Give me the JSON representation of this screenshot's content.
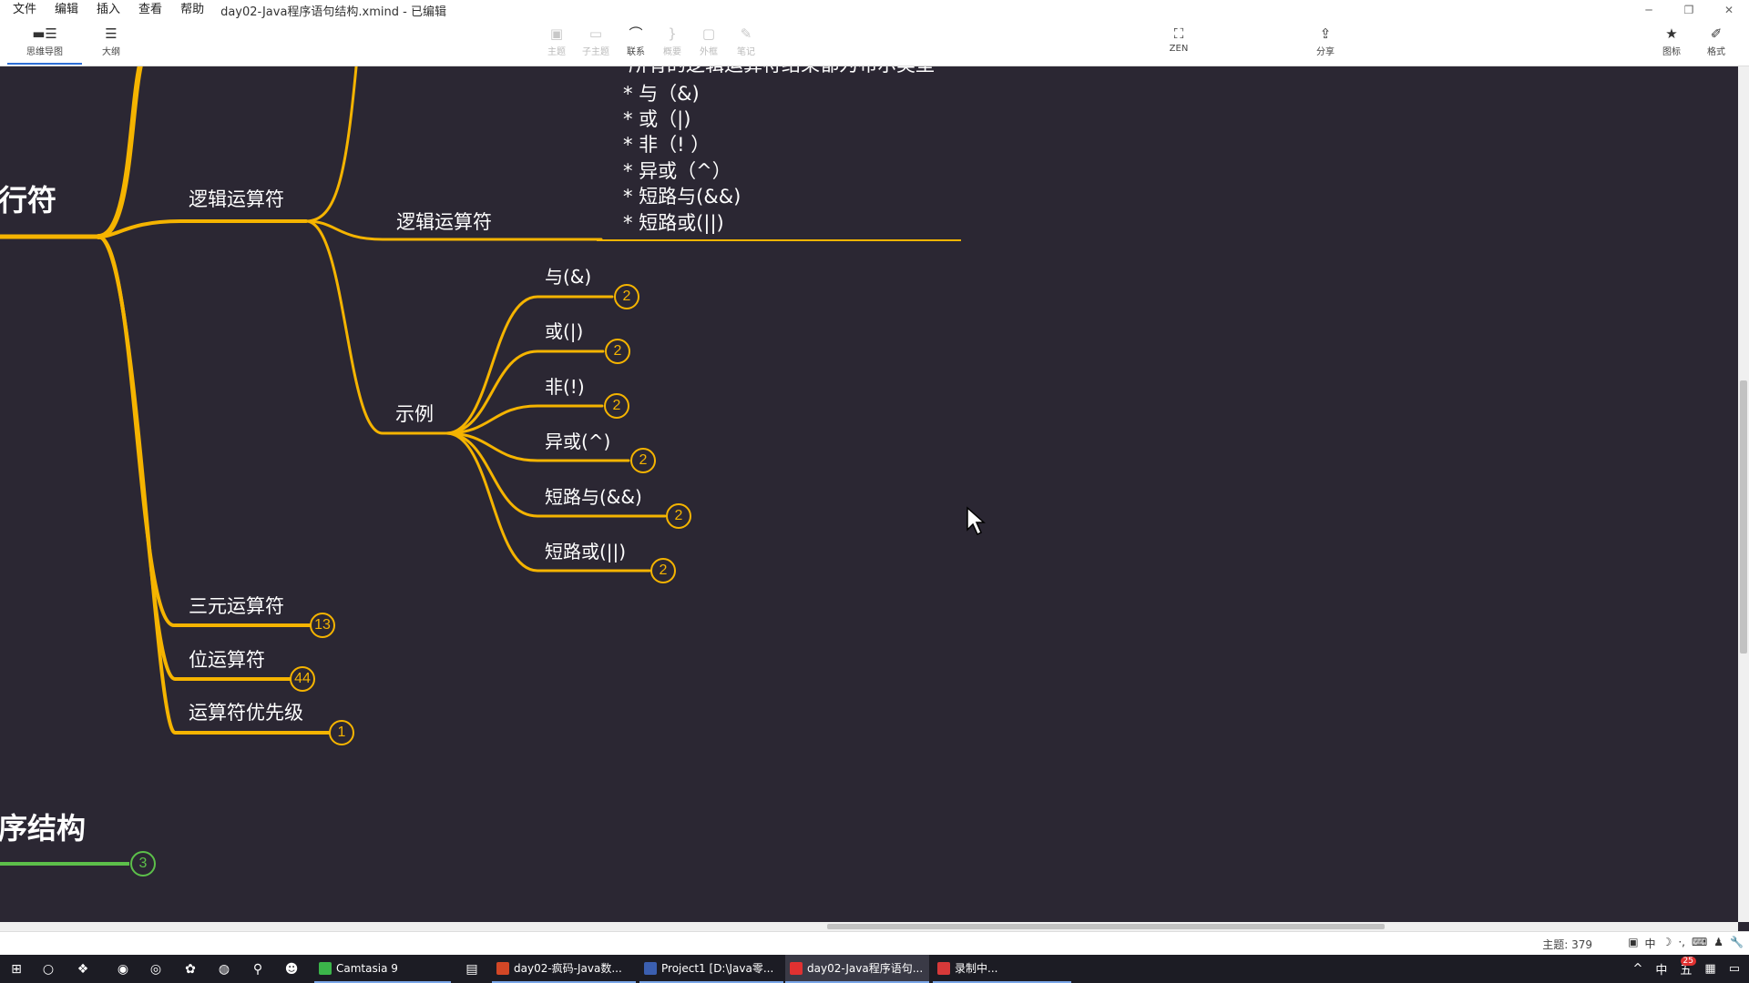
{
  "menubar": {
    "items": [
      "文件",
      "编辑",
      "插入",
      "查看",
      "帮助"
    ],
    "doc_title": "day02-Java程序语句结构.xmind - 已编辑"
  },
  "toolbar": {
    "tab_mindmap": "思维导图",
    "tab_outline": "大纲",
    "topic": "主题",
    "subtopic": "子主题",
    "relation": "联系",
    "summary": "概要",
    "boundary": "外框",
    "note": "笔记",
    "zen": "ZEN",
    "share": "分享",
    "icon": "图标",
    "format": "格式"
  },
  "mindmap": {
    "root_partial": "行符",
    "logic_ops": "逻辑运算符",
    "logic_ops_child": "逻辑运算符",
    "note_lines": [
      "所有的逻辑运算符结果都为布尔类型",
      "* 与（&)",
      "* 或（|)",
      "* 非（! ）",
      "* 异或（^）",
      "* 短路与(&&)",
      "* 短路或(||)"
    ],
    "examples": "示例",
    "example_items": [
      {
        "label": "与(&)",
        "count": "2"
      },
      {
        "label": "或(|)",
        "count": "2"
      },
      {
        "label": "非(!)",
        "count": "2"
      },
      {
        "label": "异或(^)",
        "count": "2"
      },
      {
        "label": "短路与(&&)",
        "count": "2"
      },
      {
        "label": "短路或(||)",
        "count": "2"
      }
    ],
    "ternary": {
      "label": "三元运算符",
      "count": "13"
    },
    "bitwise": {
      "label": "位运算符",
      "count": "44"
    },
    "precedence": {
      "label": "运算符优先级",
      "count": "1"
    },
    "program_structure": {
      "label": "序结构",
      "count": "3"
    },
    "branch_color": "#f5b400",
    "green_color": "#5cbf4a"
  },
  "statusbar": {
    "topic_count": "主题: 379",
    "ime": [
      "中",
      "☽",
      "·,",
      "⌨",
      "♟",
      "🔧"
    ]
  },
  "taskbar": {
    "apps": [
      {
        "label": "Camtasia 9",
        "color": "#3bb54a"
      },
      {
        "label": "day02-疯码-Java数...",
        "color": "#d24726"
      },
      {
        "label": "Project1 [D:\\Java零...",
        "color": "#3b5fb0"
      },
      {
        "label": "day02-Java程序语句...",
        "color": "#e03131"
      },
      {
        "label": "录制中...",
        "color": "#d63939"
      }
    ],
    "tray": [
      "^",
      "中",
      "五"
    ],
    "notify_count": "25"
  }
}
